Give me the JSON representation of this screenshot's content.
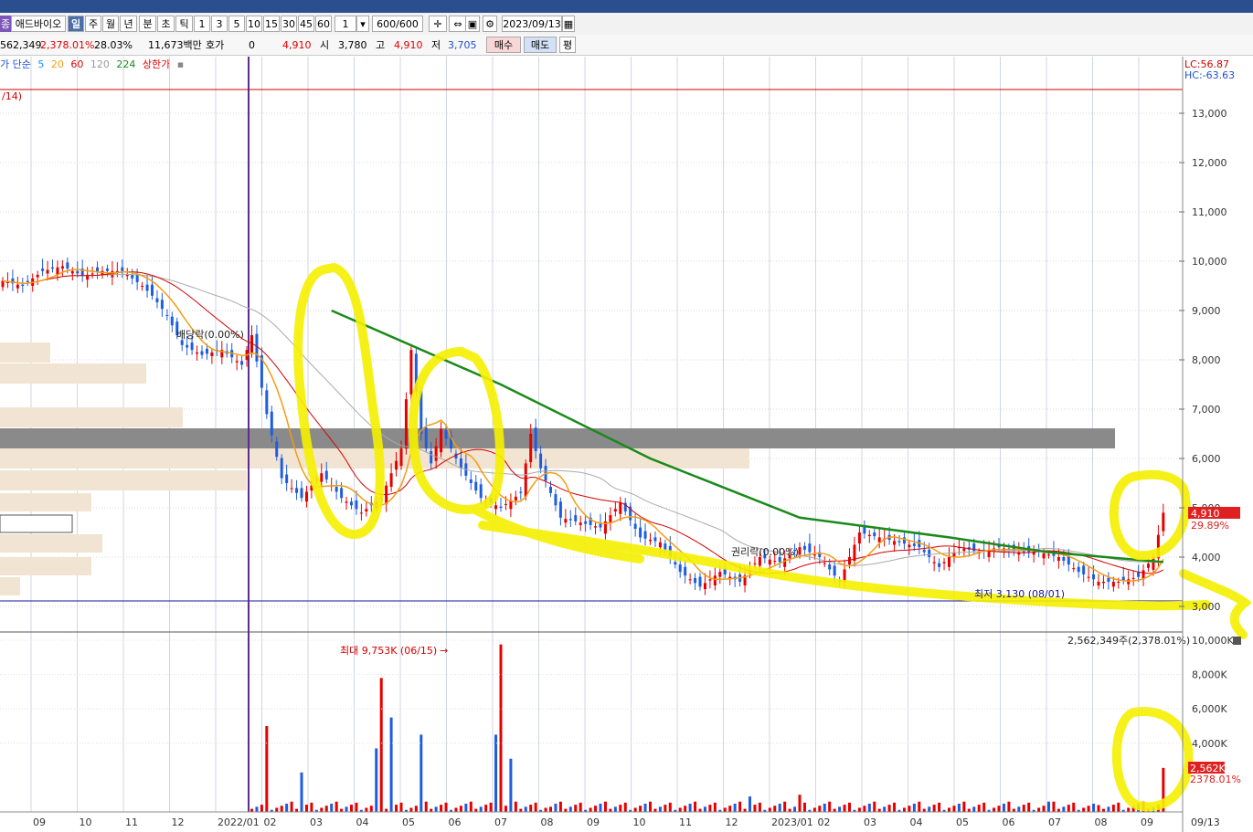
{
  "toolbar": {
    "stock_name": "애드바이오",
    "periods": [
      "일",
      "주",
      "월",
      "년",
      "분",
      "초",
      "틱"
    ],
    "minute_options": [
      "1",
      "3",
      "5",
      "10",
      "15",
      "30",
      "45",
      "60"
    ],
    "count_value": "1",
    "range_value": "600/600",
    "date_value": "2023/09/13"
  },
  "quote": {
    "volume": "562,349",
    "volume_pct": "2,378.01%",
    "turnover": "28.03%",
    "amount": "11,673백만",
    "hoga_label": "호가",
    "hoga_value": "0",
    "current": "4,910",
    "open_label": "시",
    "open": "3,780",
    "high_label": "고",
    "high": "4,910",
    "low_label": "저",
    "low": "3,705",
    "buy_label": "매수",
    "sell_label": "매도",
    "avg_label": "평"
  },
  "legend": {
    "prefix": "가 단순",
    "ma": [
      {
        "label": "5",
        "color": "#1e90ff"
      },
      {
        "label": "20",
        "color": "#f39c12"
      },
      {
        "label": "60",
        "color": "#e00000"
      },
      {
        "label": "120",
        "color": "#999999"
      },
      {
        "label": "224",
        "color": "#1a8a1a"
      }
    ],
    "limit_label": "상한가"
  },
  "annotations": {
    "fraction_label": "/14)",
    "lc": "LC:56.87",
    "hc": "HC:-63.63",
    "ex_label_1": "배당락(0.00%)",
    "ex_label_2": "권리락(0.00%)",
    "low_label": "최저 3,130 (08/01)",
    "max_vol_label": "최대 9,753K (06/15)",
    "price_tag": "4,910",
    "price_pct": "29.89%",
    "vol_readout": "2,562,349주(2,378.01%)",
    "vol_tag": "2,562K",
    "vol_pct": "2378.01%"
  },
  "chart_data": [
    {
      "type": "candlestick",
      "title": "애드바이오",
      "x_ticks": [
        "09",
        "10",
        "11",
        "12",
        "2022/01",
        "02",
        "03",
        "04",
        "05",
        "06",
        "07",
        "08",
        "09",
        "10",
        "11",
        "12",
        "2023/01",
        "02",
        "03",
        "04",
        "05",
        "06",
        "07",
        "08",
        "09",
        "09/13"
      ],
      "y_ticks": [
        "3,000",
        "4,000",
        "5,000",
        "6,000",
        "7,000",
        "8,000",
        "9,000",
        "10,000",
        "11,000",
        "12,000",
        "13,000"
      ],
      "ylim": [
        2500,
        13800
      ],
      "close_series": [
        [
          0,
          9600
        ],
        [
          4,
          9500
        ],
        [
          8,
          9800
        ],
        [
          12,
          9900
        ],
        [
          16,
          9700
        ],
        [
          20,
          9800
        ],
        [
          24,
          9800
        ],
        [
          28,
          9500
        ],
        [
          30,
          9300
        ],
        [
          33,
          8900
        ],
        [
          36,
          8300
        ],
        [
          40,
          8100
        ],
        [
          44,
          8200
        ],
        [
          48,
          7900
        ],
        [
          50,
          8500
        ],
        [
          53,
          6900
        ],
        [
          56,
          5600
        ],
        [
          60,
          5200
        ],
        [
          64,
          5700
        ],
        [
          68,
          5200
        ],
        [
          72,
          4900
        ],
        [
          76,
          5200
        ],
        [
          80,
          6200
        ],
        [
          82,
          8200
        ],
        [
          84,
          6500
        ],
        [
          86,
          5900
        ],
        [
          88,
          6600
        ],
        [
          92,
          5800
        ],
        [
          96,
          5200
        ],
        [
          100,
          5000
        ],
        [
          104,
          5300
        ],
        [
          106,
          6500
        ],
        [
          108,
          5800
        ],
        [
          112,
          4800
        ],
        [
          116,
          4700
        ],
        [
          120,
          4600
        ],
        [
          124,
          5100
        ],
        [
          128,
          4400
        ],
        [
          132,
          4300
        ],
        [
          136,
          3700
        ],
        [
          140,
          3400
        ],
        [
          144,
          3700
        ],
        [
          148,
          3500
        ],
        [
          152,
          4000
        ],
        [
          156,
          3900
        ],
        [
          160,
          4200
        ],
        [
          164,
          4000
        ],
        [
          168,
          3500
        ],
        [
          172,
          4500
        ],
        [
          176,
          4400
        ],
        [
          180,
          4300
        ],
        [
          184,
          4200
        ],
        [
          188,
          3800
        ],
        [
          192,
          4200
        ],
        [
          196,
          4100
        ],
        [
          200,
          4200
        ],
        [
          204,
          4100
        ],
        [
          208,
          4100
        ],
        [
          212,
          4000
        ],
        [
          216,
          3700
        ],
        [
          220,
          3500
        ],
        [
          224,
          3500
        ],
        [
          228,
          3600
        ],
        [
          231,
          4000
        ],
        [
          233,
          4900
        ]
      ],
      "ma224": [
        [
          66,
          9000
        ],
        [
          100,
          7500
        ],
        [
          130,
          6000
        ],
        [
          160,
          4800
        ],
        [
          190,
          4400
        ],
        [
          210,
          4100
        ],
        [
          233,
          3900
        ]
      ],
      "volume_ylim": [
        0,
        10000
      ],
      "volume_ticks": [
        "4,000K",
        "6,000K",
        "8,000K",
        "10,000K"
      ],
      "volume_peaks": [
        [
          53,
          5000
        ],
        [
          60,
          2300
        ],
        [
          75,
          3700
        ],
        [
          76,
          7800
        ],
        [
          78,
          5500
        ],
        [
          84,
          4500
        ],
        [
          99,
          4500
        ],
        [
          100,
          9753
        ],
        [
          102,
          3100
        ],
        [
          110,
          300
        ],
        [
          150,
          900
        ],
        [
          160,
          1000
        ],
        [
          210,
          600
        ],
        [
          220,
          400
        ],
        [
          233,
          2562
        ]
      ]
    }
  ]
}
